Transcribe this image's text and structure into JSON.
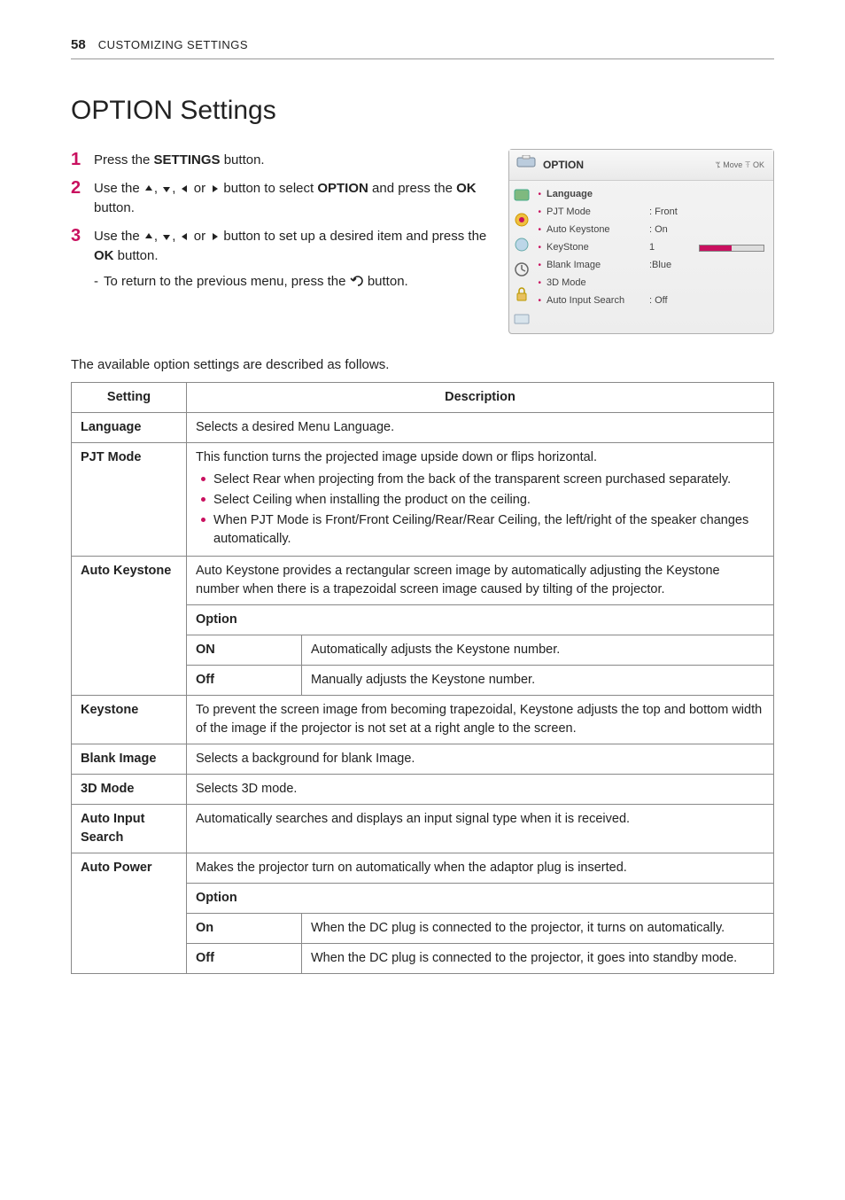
{
  "header": {
    "page_number": "58",
    "section": "CUSTOMIZING SETTINGS"
  },
  "title": "OPTION Settings",
  "steps": {
    "s1": {
      "num": "1",
      "pre": "Press the ",
      "bold": "SETTINGS",
      "post": " button."
    },
    "s2": {
      "num": "2",
      "text_a": "Use the ",
      "text_b": " button to select ",
      "bold": "OPTION",
      "text_c": " and press the ",
      "ok": "OK",
      "text_d": " button."
    },
    "s3": {
      "num": "3",
      "text_a": "Use the ",
      "text_b": " button to set up a desired item and press the ",
      "ok": "OK",
      "text_c": " button."
    },
    "sub": {
      "text_a": "To return to the previous menu, press the ",
      "text_b": " button."
    }
  },
  "osd": {
    "title": "OPTION",
    "hint": "ꔂ Move ꔉ OK",
    "rows": [
      {
        "label": "Language",
        "value": "",
        "bold": true
      },
      {
        "label": "PJT Mode",
        "value": ": Front"
      },
      {
        "label": "Auto Keystone",
        "value": ": On"
      },
      {
        "label": "KeyStone",
        "value": "1",
        "bar": true
      },
      {
        "label": "Blank Image",
        "value": ":Blue"
      },
      {
        "label": "3D Mode",
        "value": ""
      },
      {
        "label": "Auto Input Search",
        "value": ": Off"
      }
    ]
  },
  "intro": "The available option settings are described as follows.",
  "table": {
    "head_setting": "Setting",
    "head_desc": "Description",
    "language": {
      "name": "Language",
      "desc": "Selects a desired Menu Language."
    },
    "pjt": {
      "name": "PJT Mode",
      "desc": "This function turns the projected image upside down or flips horizontal.",
      "b1a": "Select ",
      "b1b": "Rear",
      "b1c": " when projecting from the back of the transparent screen purchased separately.",
      "b2a": "Select ",
      "b2b": "Ceiling",
      "b2c": " when installing the product on the ceiling.",
      "b3a": "When ",
      "b3b": "PJT Mode",
      "b3c": " is ",
      "b3d": "Front/Front Ceiling/Rear/Rear Ceiling",
      "b3e": ", the left/right of the speaker changes automatically."
    },
    "autokey": {
      "name": "Auto Keystone",
      "desc": "Auto Keystone provides a rectangular screen image by automatically adjusting the Keystone number when there is a trapezoidal screen image caused by tilting of the projector.",
      "option_label": "Option",
      "on_label": "ON",
      "on_desc": "Automatically adjusts the Keystone number.",
      "off_label": "Off",
      "off_desc": "Manually adjusts the Keystone number."
    },
    "keystone": {
      "name": "Keystone",
      "desc": "To prevent the screen image from becoming trapezoidal, Keystone adjusts the top and bottom width of the image if the projector is not set at a right angle to the screen."
    },
    "blank": {
      "name": "Blank Image",
      "desc": "Selects a background for blank Image."
    },
    "mode3d": {
      "name": "3D Mode",
      "desc": "Selects 3D mode."
    },
    "autoinput": {
      "name": "Auto Input Search",
      "desc": "Automatically searches and displays an input signal type when it is received."
    },
    "autopower": {
      "name": "Auto Power",
      "desc": "Makes the projector turn on automatically when the adaptor plug is inserted.",
      "option_label": "Option",
      "on_label": "On",
      "on_desc": "When the DC plug is connected to the projector, it turns on automatically.",
      "off_label": "Off",
      "off_desc": "When the DC plug is connected to the projector, it goes into standby mode."
    }
  }
}
